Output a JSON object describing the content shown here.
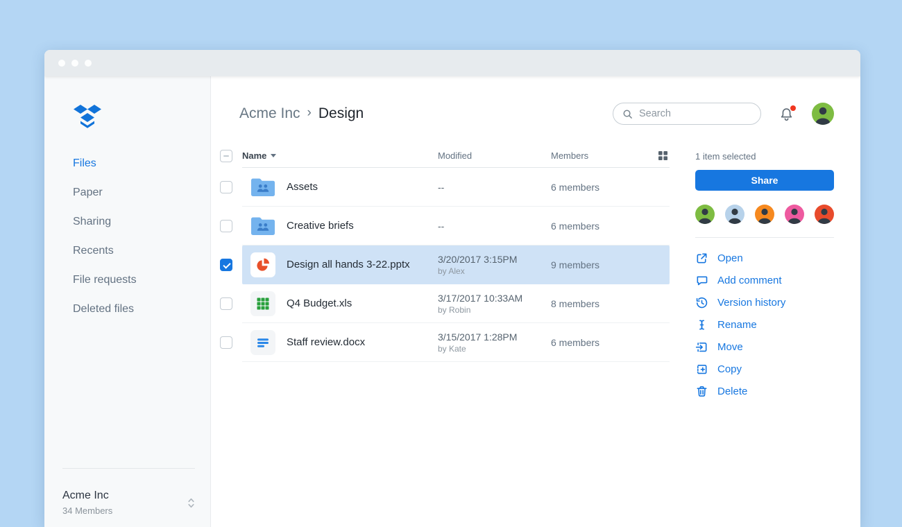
{
  "colors": {
    "accent": "#1777e0",
    "logo_blue": "#1173d9",
    "selected_row_bg": "#cfe2f6",
    "notification_dot": "#f0361f"
  },
  "sidebar": {
    "items": [
      {
        "label": "Files",
        "active": true
      },
      {
        "label": "Paper",
        "active": false
      },
      {
        "label": "Sharing",
        "active": false
      },
      {
        "label": "Recents",
        "active": false
      },
      {
        "label": "File requests",
        "active": false
      },
      {
        "label": "Deleted files",
        "active": false
      }
    ],
    "team": {
      "name": "Acme Inc",
      "members": "34 Members"
    }
  },
  "header": {
    "breadcrumb": {
      "parent": "Acme Inc",
      "separator": "›",
      "current": "Design"
    },
    "search_placeholder": "Search"
  },
  "table": {
    "headers": {
      "name": "Name",
      "modified": "Modified",
      "members": "Members"
    },
    "rows": [
      {
        "name": "Assets",
        "type": "shared-folder",
        "modified": "--",
        "modified_by": "",
        "members": "6 members",
        "selected": false
      },
      {
        "name": "Creative briefs",
        "type": "shared-folder",
        "modified": "--",
        "modified_by": "",
        "members": "6 members",
        "selected": false
      },
      {
        "name": "Design all hands 3-22.pptx",
        "type": "powerpoint",
        "modified": "3/20/2017 3:15PM",
        "modified_by": "by Alex",
        "members": "9 members",
        "selected": true
      },
      {
        "name": "Q4 Budget.xls",
        "type": "excel",
        "modified": "3/17/2017 10:33AM",
        "modified_by": "by Robin",
        "members": "8 members",
        "selected": false
      },
      {
        "name": "Staff review.docx",
        "type": "word",
        "modified": "3/15/2017 1:28PM",
        "modified_by": "by Kate",
        "members": "6 members",
        "selected": false
      }
    ]
  },
  "details": {
    "status": "1 item selected",
    "share_label": "Share",
    "avatars": [
      {
        "color": "#7ebc42"
      },
      {
        "color": "#b7d2ea"
      },
      {
        "color": "#f6891f"
      },
      {
        "color": "#ee5a9f"
      },
      {
        "color": "#e84b2c"
      }
    ],
    "actions": [
      {
        "icon": "open",
        "label": "Open"
      },
      {
        "icon": "comment",
        "label": "Add comment"
      },
      {
        "icon": "history",
        "label": "Version history"
      },
      {
        "icon": "rename",
        "label": "Rename"
      },
      {
        "icon": "move",
        "label": "Move"
      },
      {
        "icon": "copy",
        "label": "Copy"
      },
      {
        "icon": "delete",
        "label": "Delete"
      }
    ]
  }
}
